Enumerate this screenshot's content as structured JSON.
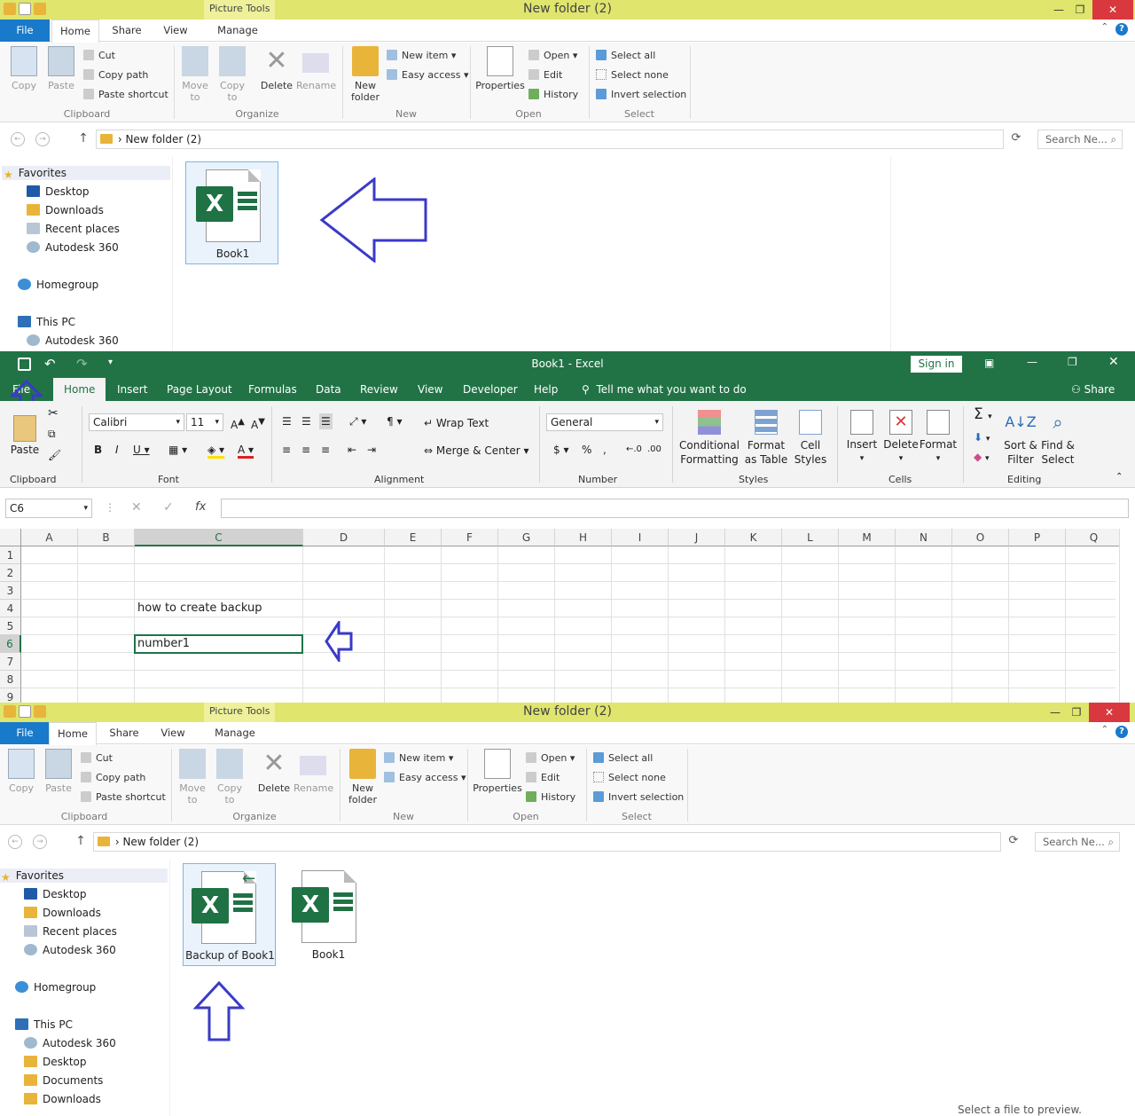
{
  "explorer_top": {
    "title": "New folder (2)",
    "contextual_tab": "Picture Tools",
    "tabs": [
      "File",
      "Home",
      "Share",
      "View",
      "Manage"
    ],
    "clipboard": {
      "copy": "Copy",
      "paste": "Paste",
      "cut": "Cut",
      "copy_path": "Copy path",
      "paste_shortcut": "Paste shortcut",
      "label": "Clipboard"
    },
    "organize": {
      "move_to": "Move to",
      "copy_to": "Copy to",
      "delete": "Delete",
      "rename": "Rename",
      "label": "Organize"
    },
    "new": {
      "new_folder": "New folder",
      "new_item": "New item",
      "easy_access": "Easy access",
      "label": "New"
    },
    "open": {
      "properties": "Properties",
      "open": "Open",
      "edit": "Edit",
      "history": "History",
      "label": "Open"
    },
    "select": {
      "select_all": "Select all",
      "select_none": "Select none",
      "invert": "Invert selection",
      "label": "Select"
    },
    "address": "New folder (2)",
    "search_placeholder": "Search Ne...",
    "nav": [
      "Favorites",
      "Desktop",
      "Downloads",
      "Recent places",
      "Autodesk 360",
      "Homegroup",
      "This PC",
      "Autodesk 360"
    ],
    "files": [
      "Book1"
    ]
  },
  "excel": {
    "title": "Book1  -  Excel",
    "sign_in": "Sign in",
    "tabs": [
      "File",
      "Home",
      "Insert",
      "Page Layout",
      "Formulas",
      "Data",
      "Review",
      "View",
      "Developer",
      "Help"
    ],
    "tell_me": "Tell me what you want to do",
    "share": "Share",
    "paste": "Paste",
    "clipboard_label": "Clipboard",
    "font_name": "Calibri",
    "font_size": "11",
    "font_label": "Font",
    "wrap_text": "Wrap Text",
    "merge_center": "Merge & Center",
    "alignment_label": "Alignment",
    "number_format": "General",
    "number_label": "Number",
    "conditional": "Conditional Formatting",
    "format_table": "Format as Table",
    "cell_styles": "Cell Styles",
    "styles_label": "Styles",
    "insert": "Insert",
    "delete": "Delete",
    "format": "Format",
    "cells_label": "Cells",
    "sort_filter": "Sort & Filter",
    "find_select": "Find & Select",
    "editing_label": "Editing",
    "name_box": "C6",
    "columns": [
      "A",
      "B",
      "C",
      "D",
      "E",
      "F",
      "G",
      "H",
      "I",
      "J",
      "K",
      "L",
      "M",
      "N",
      "O",
      "P",
      "Q"
    ],
    "rows": [
      "1",
      "2",
      "3",
      "4",
      "5",
      "6",
      "7",
      "8",
      "9"
    ],
    "cell_c4": "how to create backup",
    "cell_c6": "number1"
  },
  "explorer_bottom": {
    "title": "New folder (2)",
    "contextual_tab": "Picture Tools",
    "address": "New folder (2)",
    "search_placeholder": "Search Ne...",
    "nav": [
      "Favorites",
      "Desktop",
      "Downloads",
      "Recent places",
      "Autodesk 360",
      "Homegroup",
      "This PC",
      "Autodesk 360",
      "Desktop",
      "Documents",
      "Downloads"
    ],
    "files": [
      "Backup of Book1",
      "Book1"
    ],
    "preview_hint": "Select a file to preview."
  },
  "colors": {
    "excel_green": "#217346",
    "accent_blue": "#1979ca",
    "title_yellow": "#dfe56d",
    "arrow_blue": "#3a3ac8"
  }
}
